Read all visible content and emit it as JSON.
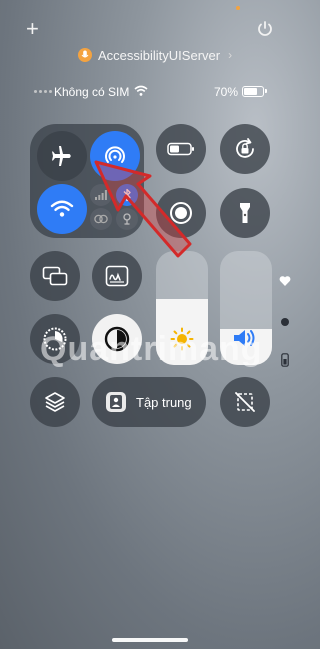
{
  "header": {
    "plus_symbol": "+",
    "server_name": "AccessibilityUIServer",
    "server_chevron": "›"
  },
  "status_bar": {
    "carrier": "Không có SIM",
    "battery_percent": "70%",
    "battery_level": 0.7
  },
  "connectivity": {
    "airplane_mode": "airplane-icon",
    "airdrop": "airdrop-icon",
    "wifi": "wifi-icon",
    "cellular": "cellular-icon",
    "hotspot": "hotspot-icon",
    "bluetooth": "bluetooth-icon"
  },
  "controls": {
    "focus_label": "Tập trung",
    "brightness_level": 0.58,
    "volume_level": 0.32
  },
  "watermark": {
    "text": "Quantrimang"
  },
  "colors": {
    "accent_blue": "#2f7cf6",
    "arrow_red": "#d32a2a",
    "mic_orange": "#f4a340"
  }
}
